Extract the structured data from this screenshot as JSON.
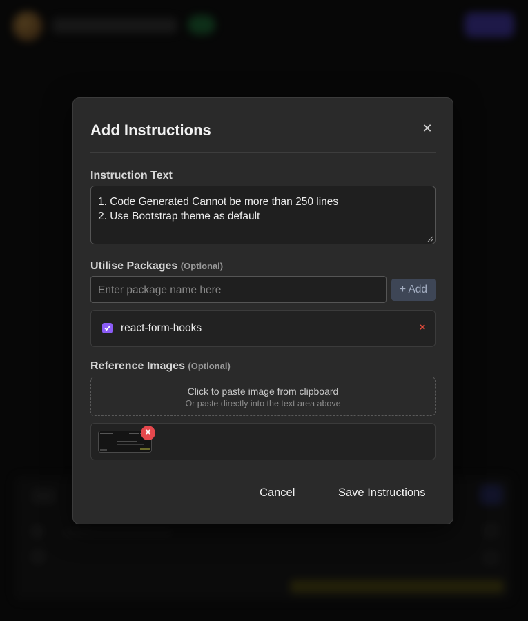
{
  "modal": {
    "title": "Add Instructions",
    "close_symbol": "✕"
  },
  "instruction": {
    "label": "Instruction Text",
    "value": "1. Code Generated Cannot be more than 250 lines\n2. Use Bootstrap theme as default"
  },
  "packages": {
    "label": "Utilise Packages",
    "optional": "(Optional)",
    "placeholder": "Enter package name here",
    "add_label": "+ Add",
    "items": [
      {
        "name": "react-form-hooks",
        "checked": true,
        "remove_symbol": "×"
      }
    ]
  },
  "images": {
    "label": "Reference Images",
    "optional": "(Optional)",
    "paste_main": "Click to paste image from clipboard",
    "paste_sub": "Or paste directly into the text area above",
    "remove_symbol": "✖"
  },
  "footer": {
    "cancel_label": "Cancel",
    "save_label": "Save Instructions"
  },
  "colors": {
    "accent_checkbox": "#8b5cf6",
    "remove_red": "#e74c3c",
    "modal_bg": "#2a2a2a"
  }
}
